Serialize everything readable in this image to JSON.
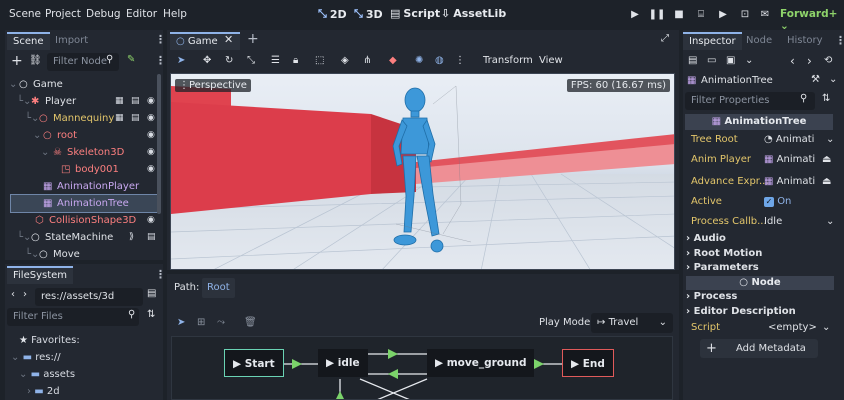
{
  "menubar": {
    "items": [
      "Scene",
      "Project",
      "Debug",
      "Editor",
      "Help"
    ],
    "workspaces": {
      "w2d": "2D",
      "w3d": "3D",
      "script": "Script",
      "assetlib": "AssetLib"
    },
    "renderer": "Forward+"
  },
  "scene_dock": {
    "tabs": [
      "Scene",
      "Import"
    ],
    "filter_placeholder": "Filter Node",
    "tree": [
      {
        "label": "Game",
        "color": "#dfe2e7"
      },
      {
        "label": "Player",
        "color": "#dfe2e7"
      },
      {
        "label": "Mannequiny",
        "color": "#e3c66b"
      },
      {
        "label": "root",
        "color": "#fc7f7f"
      },
      {
        "label": "Skeleton3D",
        "color": "#fc7f7f"
      },
      {
        "label": "body001",
        "color": "#fc7f7f"
      },
      {
        "label": "AnimationPlayer",
        "color": "#c8a8f0"
      },
      {
        "label": "AnimationTree",
        "color": "#c8a8f0"
      },
      {
        "label": "CollisionShape3D",
        "color": "#fc7f7f"
      },
      {
        "label": "StateMachine",
        "color": "#dfe2e7"
      },
      {
        "label": "Move",
        "color": "#dfe2e7"
      }
    ]
  },
  "filesystem": {
    "tab": "FileSystem",
    "path": "res://assets/3d",
    "filter_placeholder": "Filter Files",
    "items": [
      {
        "label": "Favorites:"
      },
      {
        "label": "res://"
      },
      {
        "label": "assets"
      },
      {
        "label": "2d"
      }
    ]
  },
  "editor": {
    "tab": "Game",
    "toolbar": {
      "transform": "Transform",
      "view": "View"
    },
    "viewport": {
      "label": "Perspective",
      "fps": "FPS: 60 (16.67 ms)"
    }
  },
  "animation_tree": {
    "path_label": "Path:",
    "path_value": "Root",
    "play_mode_label": "Play Mode:",
    "play_mode_value": "Travel",
    "nodes": {
      "start": "Start",
      "idle": "idle",
      "move_ground": "move_ground",
      "end": "End"
    }
  },
  "inspector": {
    "tabs": [
      "Inspector",
      "Node",
      "History"
    ],
    "object": "AnimationTree",
    "filter_placeholder": "Filter Properties",
    "class_header": "AnimationTree",
    "properties": [
      {
        "label": "Tree Root",
        "value": "Animati"
      },
      {
        "label": "Anim Player",
        "value": "Animati"
      },
      {
        "label": "Advance Expr...",
        "value": "Animati"
      },
      {
        "label": "Active",
        "value": "On"
      },
      {
        "label": "Process Callb...",
        "value": "Idle"
      }
    ],
    "sections": [
      "Audio",
      "Root Motion",
      "Parameters"
    ],
    "node_header": "Node",
    "sections2": [
      "Process",
      "Editor Description"
    ],
    "script": {
      "label": "Script",
      "value": "<empty>"
    },
    "add_metadata": "Add Metadata"
  }
}
